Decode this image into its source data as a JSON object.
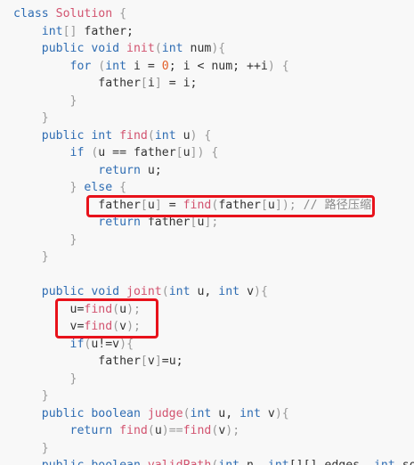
{
  "code": {
    "language": "java",
    "lines": [
      [
        {
          "t": "class ",
          "k": "kw"
        },
        {
          "t": "Solution",
          "k": "fn"
        },
        {
          "t": " {",
          "k": "brk"
        }
      ],
      [
        {
          "t": "    int",
          "k": "kw"
        },
        {
          "t": "[]",
          "k": "brk"
        },
        {
          "t": " father;",
          "k": "txt"
        }
      ],
      [
        {
          "t": "    public void ",
          "k": "kw"
        },
        {
          "t": "init",
          "k": "fn"
        },
        {
          "t": "(",
          "k": "brk"
        },
        {
          "t": "int",
          "k": "kw"
        },
        {
          "t": " num",
          "k": "txt"
        },
        {
          "t": "){",
          "k": "brk"
        }
      ],
      [
        {
          "t": "        for",
          "k": "kw"
        },
        {
          "t": " (",
          "k": "brk"
        },
        {
          "t": "int",
          "k": "kw"
        },
        {
          "t": " i = ",
          "k": "txt"
        },
        {
          "t": "0",
          "k": "num"
        },
        {
          "t": "; i < num; ++i",
          "k": "txt"
        },
        {
          "t": ") {",
          "k": "brk"
        }
      ],
      [
        {
          "t": "            father",
          "k": "txt"
        },
        {
          "t": "[",
          "k": "brk"
        },
        {
          "t": "i",
          "k": "txt"
        },
        {
          "t": "]",
          "k": "brk"
        },
        {
          "t": " = i;",
          "k": "txt"
        }
      ],
      [
        {
          "t": "        }",
          "k": "brk"
        }
      ],
      [
        {
          "t": "    }",
          "k": "brk"
        }
      ],
      [
        {
          "t": "    public int ",
          "k": "kw"
        },
        {
          "t": "find",
          "k": "fn"
        },
        {
          "t": "(",
          "k": "brk"
        },
        {
          "t": "int",
          "k": "kw"
        },
        {
          "t": " u",
          "k": "txt"
        },
        {
          "t": ") {",
          "k": "brk"
        }
      ],
      [
        {
          "t": "        if",
          "k": "kw"
        },
        {
          "t": " (",
          "k": "brk"
        },
        {
          "t": "u == father",
          "k": "txt"
        },
        {
          "t": "[",
          "k": "brk"
        },
        {
          "t": "u",
          "k": "txt"
        },
        {
          "t": "]) {",
          "k": "brk"
        }
      ],
      [
        {
          "t": "            return",
          "k": "kw"
        },
        {
          "t": " u;",
          "k": "txt"
        }
      ],
      [
        {
          "t": "        } ",
          "k": "brk"
        },
        {
          "t": "else",
          "k": "kw"
        },
        {
          "t": " {",
          "k": "brk"
        }
      ],
      [
        {
          "t": "            father",
          "k": "txt"
        },
        {
          "t": "[",
          "k": "brk"
        },
        {
          "t": "u",
          "k": "txt"
        },
        {
          "t": "]",
          "k": "brk"
        },
        {
          "t": " = ",
          "k": "txt"
        },
        {
          "t": "find",
          "k": "fn"
        },
        {
          "t": "(",
          "k": "brk"
        },
        {
          "t": "father",
          "k": "txt"
        },
        {
          "t": "[",
          "k": "brk"
        },
        {
          "t": "u",
          "k": "txt"
        },
        {
          "t": "]);",
          "k": "brk"
        },
        {
          "t": " // 路径压缩",
          "k": "cmt"
        }
      ],
      [
        {
          "t": "            return",
          "k": "kw"
        },
        {
          "t": " father",
          "k": "txt"
        },
        {
          "t": "[",
          "k": "brk"
        },
        {
          "t": "u",
          "k": "txt"
        },
        {
          "t": "];",
          "k": "brk"
        }
      ],
      [
        {
          "t": "        }",
          "k": "brk"
        }
      ],
      [
        {
          "t": "    }",
          "k": "brk"
        }
      ],
      [
        {
          "t": "",
          "k": "txt"
        }
      ],
      [
        {
          "t": "    public void ",
          "k": "kw"
        },
        {
          "t": "joint",
          "k": "fn"
        },
        {
          "t": "(",
          "k": "brk"
        },
        {
          "t": "int",
          "k": "kw"
        },
        {
          "t": " u, ",
          "k": "txt"
        },
        {
          "t": "int",
          "k": "kw"
        },
        {
          "t": " v",
          "k": "txt"
        },
        {
          "t": "){",
          "k": "brk"
        }
      ],
      [
        {
          "t": "        u=",
          "k": "txt"
        },
        {
          "t": "find",
          "k": "fn"
        },
        {
          "t": "(",
          "k": "brk"
        },
        {
          "t": "u",
          "k": "txt"
        },
        {
          "t": ");",
          "k": "brk"
        }
      ],
      [
        {
          "t": "        v=",
          "k": "txt"
        },
        {
          "t": "find",
          "k": "fn"
        },
        {
          "t": "(",
          "k": "brk"
        },
        {
          "t": "v",
          "k": "txt"
        },
        {
          "t": ");",
          "k": "brk"
        }
      ],
      [
        {
          "t": "        if",
          "k": "kw"
        },
        {
          "t": "(",
          "k": "brk"
        },
        {
          "t": "u!=v",
          "k": "txt"
        },
        {
          "t": "){",
          "k": "brk"
        }
      ],
      [
        {
          "t": "            father",
          "k": "txt"
        },
        {
          "t": "[",
          "k": "brk"
        },
        {
          "t": "v",
          "k": "txt"
        },
        {
          "t": "]",
          "k": "brk"
        },
        {
          "t": "=u;",
          "k": "txt"
        }
      ],
      [
        {
          "t": "        }",
          "k": "brk"
        }
      ],
      [
        {
          "t": "    }",
          "k": "brk"
        }
      ],
      [
        {
          "t": "    public boolean ",
          "k": "kw"
        },
        {
          "t": "judge",
          "k": "fn"
        },
        {
          "t": "(",
          "k": "brk"
        },
        {
          "t": "int",
          "k": "kw"
        },
        {
          "t": " u, ",
          "k": "txt"
        },
        {
          "t": "int",
          "k": "kw"
        },
        {
          "t": " v",
          "k": "txt"
        },
        {
          "t": "){",
          "k": "brk"
        }
      ],
      [
        {
          "t": "        return",
          "k": "kw"
        },
        {
          "t": " ",
          "k": "txt"
        },
        {
          "t": "find",
          "k": "fn"
        },
        {
          "t": "(",
          "k": "brk"
        },
        {
          "t": "u",
          "k": "txt"
        },
        {
          "t": ")==",
          "k": "brk"
        },
        {
          "t": "find",
          "k": "fn"
        },
        {
          "t": "(",
          "k": "brk"
        },
        {
          "t": "v",
          "k": "txt"
        },
        {
          "t": ");",
          "k": "brk"
        }
      ],
      [
        {
          "t": "    }",
          "k": "brk"
        }
      ],
      [
        {
          "t": "    public boolean ",
          "k": "kw"
        },
        {
          "t": "validPath",
          "k": "fn"
        },
        {
          "t": "(",
          "k": "brk"
        },
        {
          "t": "int",
          "k": "kw"
        },
        {
          "t": " n, ",
          "k": "txt"
        },
        {
          "t": "int",
          "k": "kw"
        },
        {
          "t": "[][] edges, ",
          "k": "txt"
        },
        {
          "t": "int",
          "k": "kw"
        },
        {
          "t": " sour",
          "k": "txt"
        }
      ]
    ]
  },
  "colors": {
    "highlight_border": "#e8121b",
    "keyword": "#2f6db3",
    "function": "#d2536f",
    "number": "#e35f28",
    "comment": "#8a8a8a"
  }
}
